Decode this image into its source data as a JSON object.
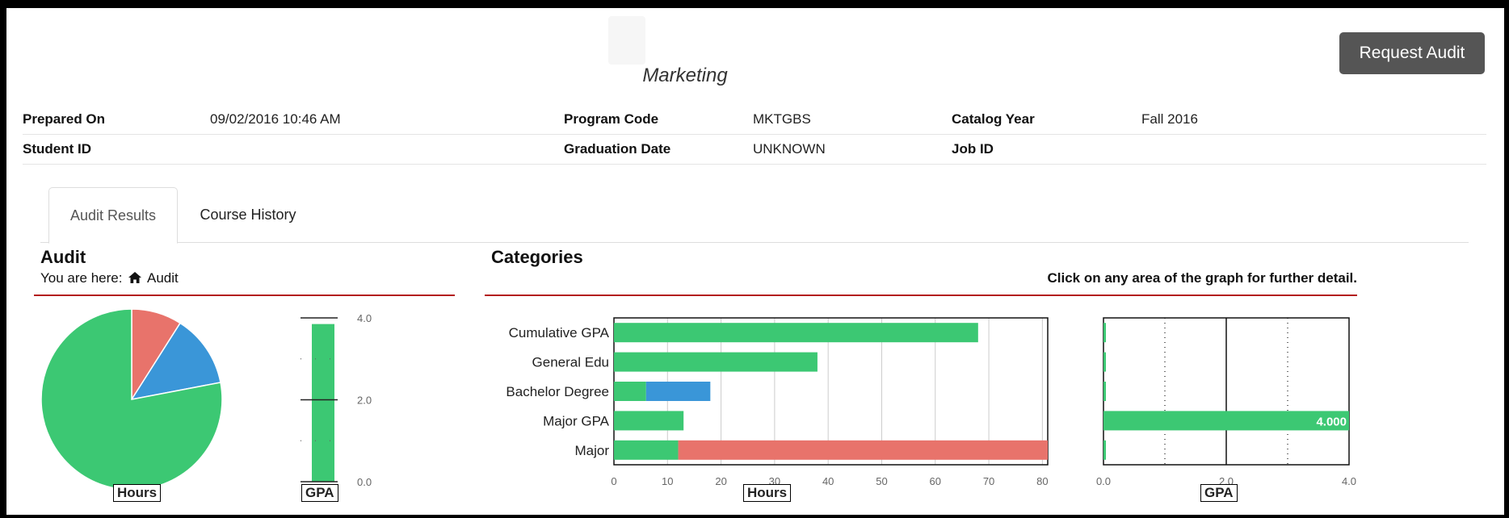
{
  "header": {
    "program_title": "Marketing",
    "request_audit_label": "Request Audit"
  },
  "info": {
    "prepared_on_label": "Prepared On",
    "prepared_on_value": "09/02/2016 10:46 AM",
    "program_code_label": "Program Code",
    "program_code_value": "MKTGBS",
    "catalog_year_label": "Catalog Year",
    "catalog_year_value": "Fall 2016",
    "student_id_label": "Student ID",
    "graduation_date_label": "Graduation Date",
    "graduation_date_value": "UNKNOWN",
    "job_id_label": "Job ID"
  },
  "tabs": [
    {
      "label": "Audit Results",
      "active": true
    },
    {
      "label": "Course History",
      "active": false
    }
  ],
  "audit": {
    "heading": "Audit",
    "breadcrumb_prefix": "You are here:",
    "breadcrumb_icon": "home-icon",
    "breadcrumb_current": "Audit"
  },
  "categories": {
    "heading": "Categories",
    "hint": "Click on any area of the graph for further detail."
  },
  "colors": {
    "green": "#3cc873",
    "red": "#e8736b",
    "blue": "#3a96d8",
    "rule": "#b31b1b"
  },
  "chart_data": [
    {
      "type": "pie",
      "id": "hours-pie",
      "xlabel": "Hours",
      "slices": [
        {
          "value": 9,
          "color": "#e8736b"
        },
        {
          "value": 13,
          "color": "#3a96d8"
        },
        {
          "value": 78,
          "color": "#3cc873"
        }
      ]
    },
    {
      "type": "bar",
      "id": "gpa-vertical",
      "xlabel": "GPA",
      "values": [
        3.85
      ],
      "ylim": [
        0,
        4.0
      ],
      "ticks": [
        "0.0",
        "2.0",
        "4.0"
      ]
    },
    {
      "type": "bar",
      "id": "category-hours",
      "orientation": "horizontal",
      "stacked": true,
      "xlabel": "Hours",
      "categories": [
        "Cumulative GPA",
        "General Edu",
        "Bachelor Degree",
        "Major GPA",
        "Major"
      ],
      "series": [
        {
          "values": [
            68,
            38,
            6,
            13,
            12
          ],
          "color": "#3cc873"
        },
        {
          "values": [
            0,
            0,
            12,
            0,
            0
          ],
          "color": "#3a96d8"
        },
        {
          "values": [
            0,
            0,
            0,
            0,
            69
          ],
          "color": "#e8736b"
        }
      ],
      "xlim": [
        0,
        81
      ],
      "ticks": [
        "0",
        "10",
        "20",
        "30",
        "40",
        "50",
        "60",
        "70",
        "80"
      ]
    },
    {
      "type": "bar",
      "id": "category-gpa",
      "orientation": "horizontal",
      "xlabel": "GPA",
      "categories": [
        "Cumulative GPA",
        "General Edu",
        "Bachelor Degree",
        "Major GPA",
        "Major"
      ],
      "values": [
        0,
        0,
        0,
        4.0,
        0
      ],
      "data_labels": [
        "",
        "",
        "",
        "4.000",
        ""
      ],
      "xlim": [
        0,
        4.0
      ],
      "ticks": [
        "0.0",
        "2.0",
        "4.0"
      ]
    }
  ]
}
